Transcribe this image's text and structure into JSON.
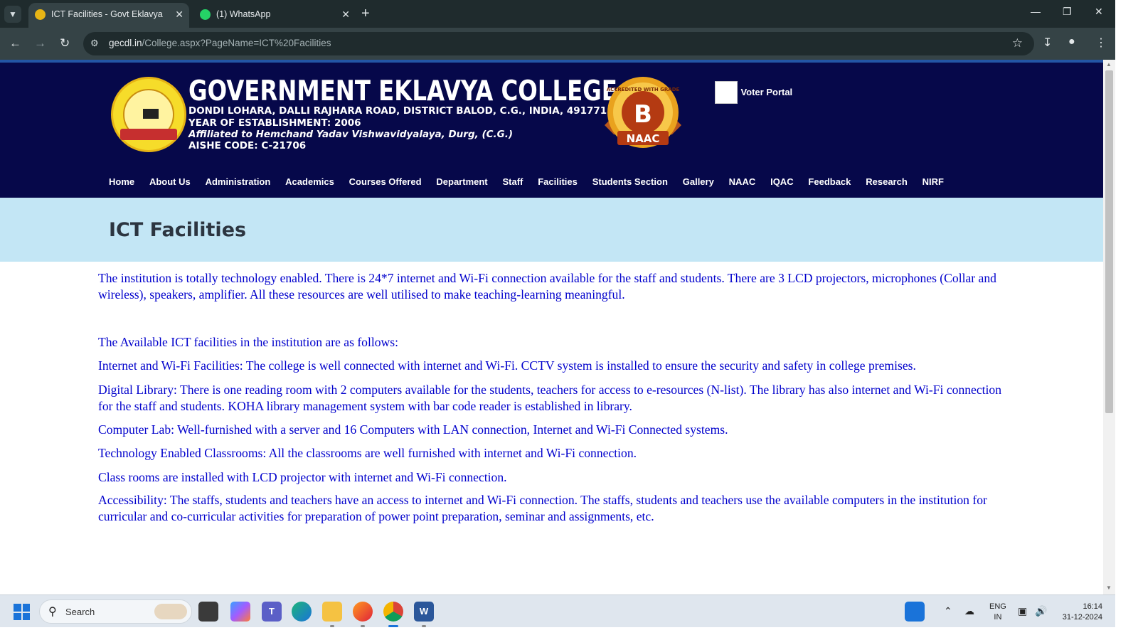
{
  "browser": {
    "tabs": [
      {
        "title": "ICT Facilities - Govt Eklavya College",
        "active": true
      },
      {
        "title": "(1) WhatsApp",
        "active": false
      }
    ],
    "url_host": "gecdl.in",
    "url_path": "/College.aspx?PageName=ICT%20Facilities"
  },
  "header": {
    "college_name": "GOVERNMENT EKLAVYA COLLEGE",
    "address": "DONDI LOHARA, DALLI RAJHARA ROAD, DISTRICT BALOD, C.G., INDIA, 491771",
    "established": "YEAR OF ESTABLISHMENT: 2006",
    "affiliation": "Affiliated to Hemchand Yadav Vishwavidyalaya, Durg, (C.G.)",
    "aishe": "AISHE CODE: C-21706",
    "naac_badge": {
      "grade": "B",
      "ring_text": "ACCREDITED WITH GRADE",
      "label": "NAAC"
    },
    "voter_portal": "Voter Portal"
  },
  "nav": [
    "Home",
    "About Us",
    "Administration",
    "Academics",
    "Courses Offered",
    "Department",
    "Staff",
    "Facilities",
    "Students Section",
    "Gallery",
    "NAAC",
    "IQAC",
    "Feedback",
    "Research",
    "NIRF"
  ],
  "page": {
    "title": "ICT Facilities",
    "paragraphs": [
      "The institution is totally technology enabled. There is 24*7 internet and Wi-Fi connection available for the staff and students. There are 3 LCD projectors, microphones (Collar and wireless), speakers, amplifier. All these resources are well utilised to make teaching-learning meaningful.",
      "The Available ICT facilities in the institution are as follows:",
      "Internet and Wi-Fi Facilities: The college is well connected with internet and Wi-Fi. CCTV system is installed to ensure the security and safety in college premises.",
      "Digital Library: There is one reading room with 2 computers available for the students, teachers for access to e-resources (N-list). The library has also internet and Wi-Fi connection for the staff and students. KOHA library management system with bar code reader is established in library.",
      "Computer Lab: Well-furnished with a server and 16 Computers with  LAN connection, Internet and Wi-Fi Connected systems.",
      "Technology Enabled Classrooms: All the classrooms are well furnished with internet and Wi-Fi connection.",
      "Class rooms are installed with LCD projector with internet and Wi-Fi connection.",
      "Accessibility: The staffs, students and teachers have an access to internet and Wi-Fi connection. The staffs, students and teachers use the available computers in the institution for curricular and co-curricular activities for preparation of power point preparation, seminar and assignments, etc."
    ]
  },
  "taskbar": {
    "search_placeholder": "Search",
    "language": "ENG",
    "region": "IN",
    "time": "16:14",
    "date": "31-12-2024"
  },
  "colors": {
    "header_bg": "#06084a",
    "title_band": "#c3e6f5",
    "body_text": "#0000cc",
    "chrome_dark": "#1f2b2d"
  }
}
